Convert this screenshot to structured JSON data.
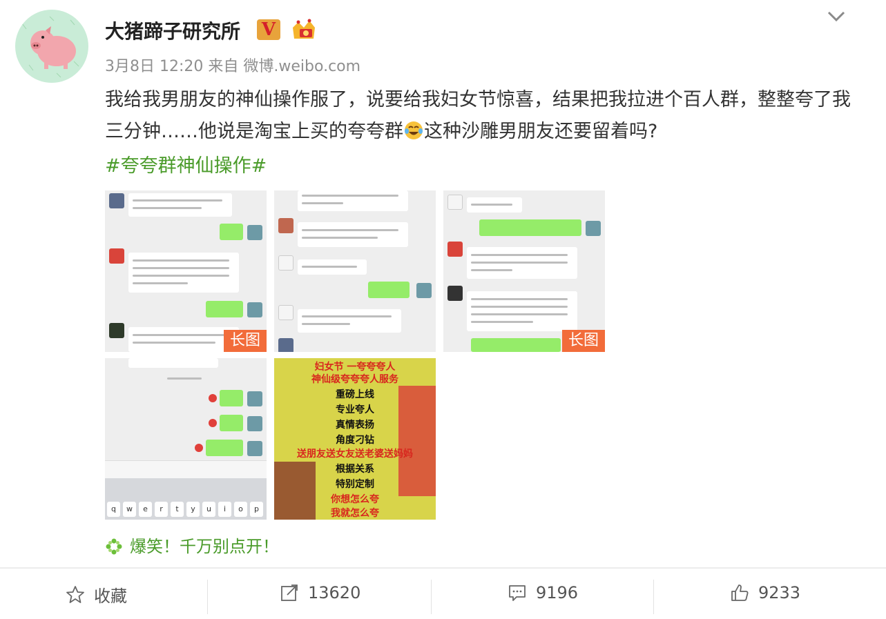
{
  "post": {
    "username": "大猪蹄子研究所",
    "verified_badge": "V",
    "timestamp": "3月8日 12:20",
    "source_label": "来自",
    "source": "微博.weibo.com",
    "text_part1": "我给我男朋友的神仙操作服了，说要给我妇女节惊喜，结果把我拉进个百人群，整整夸了我三分钟……他说是淘宝上买的夸夸群",
    "text_part2": "这种沙雕男朋友还要留着吗?",
    "hashtag": "#夸夸群神仙操作#",
    "long_image_label": "长图",
    "poster_lines": [
      "妇女节 一夸夸夸人",
      "神仙级夸夸夸人服务",
      "重磅上线",
      "专业夸人",
      "真情表扬",
      "角度刁钻",
      "送朋友送女友送老婆送妈妈",
      "根据关系",
      "特别定制",
      "你想怎么夸",
      "我就怎么夸"
    ],
    "footer_note": "爆笑！千万别点开！"
  },
  "actions": {
    "favorite_label": "收藏",
    "repost_count": "13620",
    "comment_count": "9196",
    "like_count": "9233"
  },
  "colors": {
    "link_green": "#4a9b2a",
    "long_badge": "#f26c3a",
    "chat_green": "#95ec69"
  }
}
